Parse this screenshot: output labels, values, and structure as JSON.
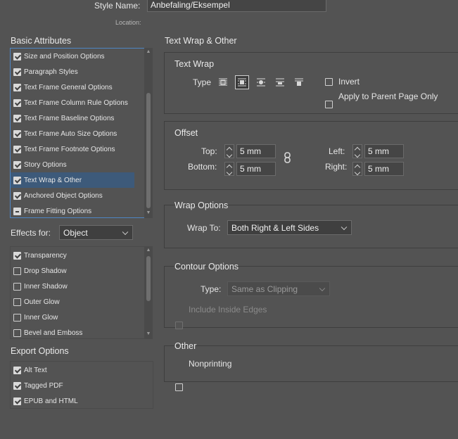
{
  "style_name": {
    "label": "Style Name:",
    "value": "Anbefaling/Eksempel"
  },
  "location": {
    "label": "Location:"
  },
  "basic_attributes": {
    "heading": "Basic Attributes",
    "items": [
      {
        "label": "Size and Position Options",
        "state": "checked"
      },
      {
        "label": "Paragraph Styles",
        "state": "checked"
      },
      {
        "label": "Text Frame General Options",
        "state": "checked"
      },
      {
        "label": "Text Frame Column Rule Options",
        "state": "checked"
      },
      {
        "label": "Text Frame Baseline Options",
        "state": "checked"
      },
      {
        "label": "Text Frame Auto Size Options",
        "state": "checked"
      },
      {
        "label": "Text Frame Footnote Options",
        "state": "checked"
      },
      {
        "label": "Story Options",
        "state": "checked"
      },
      {
        "label": "Text Wrap & Other",
        "state": "checked",
        "selected": true
      },
      {
        "label": "Anchored Object Options",
        "state": "checked"
      },
      {
        "label": "Frame Fitting Options",
        "state": "mixed"
      }
    ]
  },
  "effects_for": {
    "label": "Effects for:",
    "value": "Object",
    "items": [
      {
        "label": "Transparency",
        "state": "checked"
      },
      {
        "label": "Drop Shadow",
        "state": "unchecked"
      },
      {
        "label": "Inner Shadow",
        "state": "unchecked"
      },
      {
        "label": "Outer Glow",
        "state": "unchecked"
      },
      {
        "label": "Inner Glow",
        "state": "unchecked"
      },
      {
        "label": "Bevel and Emboss",
        "state": "unchecked"
      }
    ]
  },
  "export_options": {
    "heading": "Export Options",
    "items": [
      {
        "label": "Alt Text",
        "state": "checked"
      },
      {
        "label": "Tagged PDF",
        "state": "checked"
      },
      {
        "label": "EPUB and HTML",
        "state": "checked"
      }
    ]
  },
  "panel_title": "Text Wrap & Other",
  "text_wrap": {
    "heading": "Text Wrap",
    "type_label": "Type",
    "icons": [
      "no-wrap-icon",
      "wrap-bounding-box-icon",
      "wrap-object-shape-icon",
      "jump-object-icon",
      "jump-to-next-column-icon"
    ],
    "active_index": 1,
    "invert_label": "Invert",
    "apply_parent_label": "Apply to Parent Page Only"
  },
  "offset": {
    "heading": "Offset",
    "top_label": "Top:",
    "top_value": "5 mm",
    "bottom_label": "Bottom:",
    "bottom_value": "5 mm",
    "left_label": "Left:",
    "left_value": "5 mm",
    "right_label": "Right:",
    "right_value": "5 mm"
  },
  "wrap_options": {
    "heading": "Wrap Options",
    "wrap_to_label": "Wrap To:",
    "wrap_to_value": "Both Right & Left Sides"
  },
  "contour_options": {
    "heading": "Contour Options",
    "type_label": "Type:",
    "type_value": "Same as Clipping",
    "include_inside_edges_label": "Include Inside Edges"
  },
  "other": {
    "heading": "Other",
    "nonprinting_label": "Nonprinting"
  }
}
